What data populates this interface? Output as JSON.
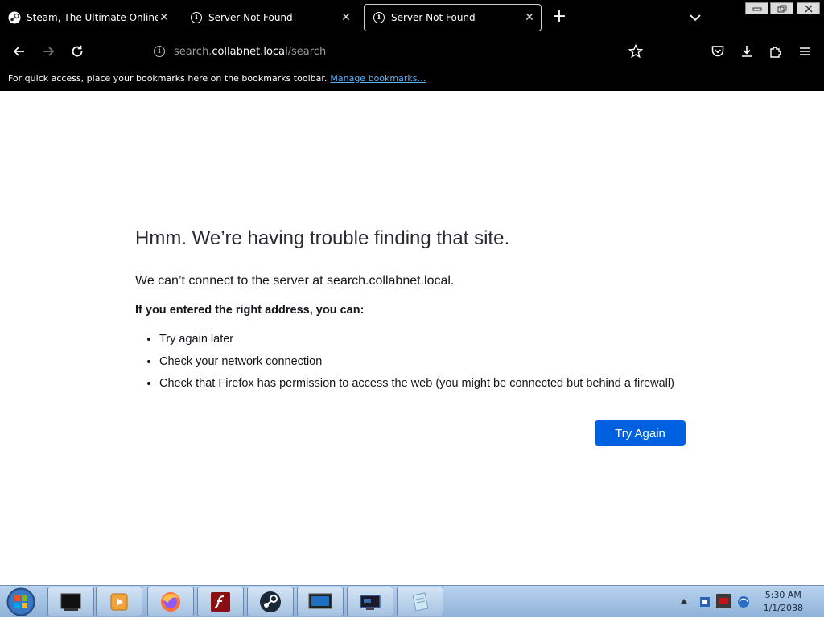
{
  "browser": {
    "tabs": [
      {
        "title": "Steam, The Ultimate Online Game Platform",
        "icon": "steam-icon",
        "active": false
      },
      {
        "title": "Server Not Found",
        "icon": "info-icon",
        "active": false
      },
      {
        "title": "Server Not Found",
        "icon": "info-icon",
        "active": true
      }
    ],
    "new_tab_label": "+",
    "url": {
      "prefix": "search.",
      "host": "collabnet.local",
      "path": "/search"
    },
    "bookmarks_bar": {
      "message": "For quick access, place your bookmarks here on the bookmarks toolbar.",
      "link": "Manage bookmarks…"
    }
  },
  "error_page": {
    "title": "Hmm. We’re having trouble finding that site.",
    "subtitle": "We can’t connect to the server at search.collabnet.local.",
    "lead": "If you entered the right address, you can:",
    "suggestions": [
      "Try again later",
      "Check your network connection",
      "Check that Firefox has permission to access the web (you might be connected but behind a firewall)"
    ],
    "button_label": "Try Again"
  },
  "taskbar": {
    "clock": {
      "time": "5:30 AM",
      "date": "1/1/2038"
    },
    "items": [
      "terminal-icon",
      "media-player-icon",
      "firefox-icon",
      "flash-icon",
      "steam-icon",
      "monitor-icon",
      "remote-desktop-icon",
      "notepad-icon"
    ]
  },
  "colors": {
    "accent": "#0061e0",
    "chrome_bg": "#000000",
    "link": "#55b4ff"
  }
}
